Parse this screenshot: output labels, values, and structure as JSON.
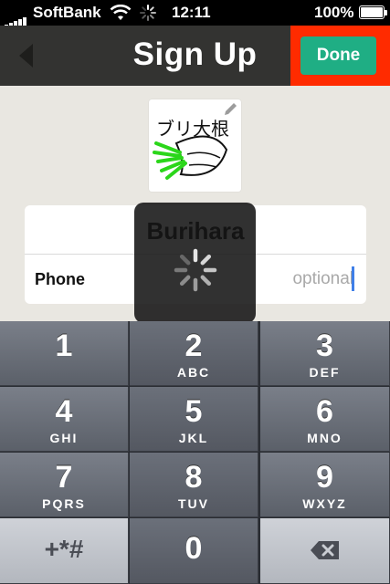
{
  "status_bar": {
    "carrier": "SoftBank",
    "time": "12:11",
    "battery": "100%"
  },
  "nav": {
    "title": "Sign Up",
    "done_label": "Done"
  },
  "avatar": {
    "text": "ブリ大根"
  },
  "form": {
    "name_value": "Burihara",
    "phone_label": "Phone",
    "phone_placeholder": "optional"
  },
  "keypad": [
    {
      "num": "1",
      "letters": ""
    },
    {
      "num": "2",
      "letters": "ABC"
    },
    {
      "num": "3",
      "letters": "DEF"
    },
    {
      "num": "4",
      "letters": "GHI"
    },
    {
      "num": "5",
      "letters": "JKL"
    },
    {
      "num": "6",
      "letters": "MNO"
    },
    {
      "num": "7",
      "letters": "PQRS"
    },
    {
      "num": "8",
      "letters": "TUV"
    },
    {
      "num": "9",
      "letters": "WXYZ"
    },
    {
      "sym": "+*#"
    },
    {
      "num": "0",
      "letters": ""
    },
    {
      "icon": "delete-icon"
    }
  ],
  "colors": {
    "done_button": "#1fae84",
    "highlight": "#ff2b00",
    "caret": "#3f7fe8"
  }
}
